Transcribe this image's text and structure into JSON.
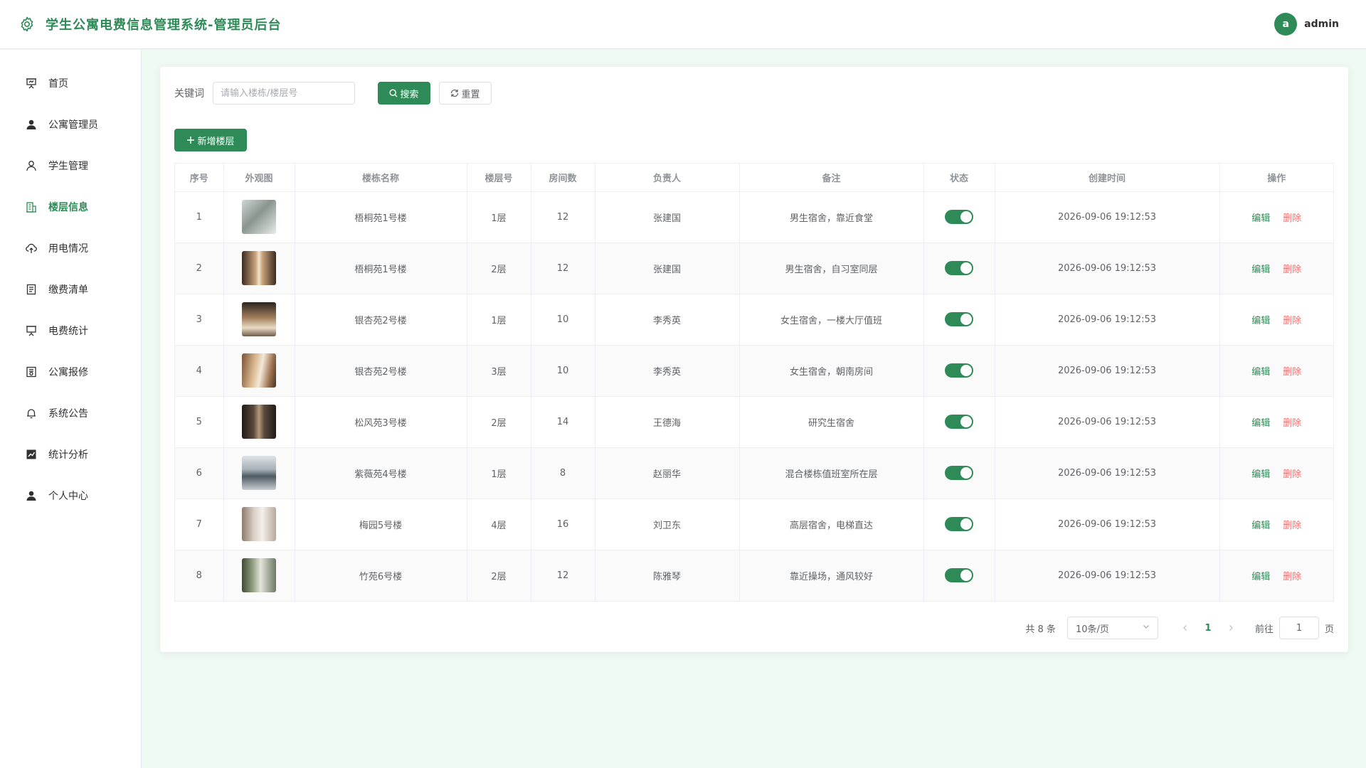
{
  "header": {
    "title": "学生公寓电费信息管理系统-管理员后台",
    "avatar_letter": "a",
    "username": "admin"
  },
  "colors": {
    "primary": "#2e8b57",
    "danger": "#f56c6c"
  },
  "sidebar": {
    "items": [
      {
        "label": "首页",
        "icon": "presentation-board-icon"
      },
      {
        "label": "公寓管理员",
        "icon": "user-filled-icon"
      },
      {
        "label": "学生管理",
        "icon": "user-outline-icon"
      },
      {
        "label": "楼层信息",
        "icon": "office-building-icon",
        "active": true
      },
      {
        "label": "用电情况",
        "icon": "upload-cloud-icon"
      },
      {
        "label": "缴费清单",
        "icon": "document-icon"
      },
      {
        "label": "电费统计",
        "icon": "monitor-board-icon"
      },
      {
        "label": "公寓报修",
        "icon": "memo-icon"
      },
      {
        "label": "系统公告",
        "icon": "bell-icon"
      },
      {
        "label": "统计分析",
        "icon": "data-line-icon"
      },
      {
        "label": "个人中心",
        "icon": "user-filled-icon"
      }
    ]
  },
  "search": {
    "label": "关键词",
    "placeholder": "请输入楼栋/楼层号",
    "search_button": "搜索",
    "reset_button": "重置"
  },
  "toolbar": {
    "add_button": "新增楼层"
  },
  "table": {
    "columns": [
      "序号",
      "外观图",
      "楼栋名称",
      "楼层号",
      "房间数",
      "负责人",
      "备注",
      "状态",
      "创建时间",
      "操作"
    ],
    "edit_label": "编辑",
    "delete_label": "删除",
    "rows": [
      {
        "index": "1",
        "building": "梧桐苑1号楼",
        "floor": "1层",
        "rooms": "12",
        "manager": "张建国",
        "remark": "男生宿舍，靠近食堂",
        "status": true,
        "created": "2026-09-06 19:12:53"
      },
      {
        "index": "2",
        "building": "梧桐苑1号楼",
        "floor": "2层",
        "rooms": "12",
        "manager": "张建国",
        "remark": "男生宿舍，自习室同层",
        "status": true,
        "created": "2026-09-06 19:12:53"
      },
      {
        "index": "3",
        "building": "银杏苑2号楼",
        "floor": "1层",
        "rooms": "10",
        "manager": "李秀英",
        "remark": "女生宿舍，一楼大厅值班",
        "status": true,
        "created": "2026-09-06 19:12:53"
      },
      {
        "index": "4",
        "building": "银杏苑2号楼",
        "floor": "3层",
        "rooms": "10",
        "manager": "李秀英",
        "remark": "女生宿舍，朝南房间",
        "status": true,
        "created": "2026-09-06 19:12:53"
      },
      {
        "index": "5",
        "building": "松风苑3号楼",
        "floor": "2层",
        "rooms": "14",
        "manager": "王德海",
        "remark": "研究生宿舍",
        "status": true,
        "created": "2026-09-06 19:12:53"
      },
      {
        "index": "6",
        "building": "紫薇苑4号楼",
        "floor": "1层",
        "rooms": "8",
        "manager": "赵丽华",
        "remark": "混合楼栋值班室所在层",
        "status": true,
        "created": "2026-09-06 19:12:53"
      },
      {
        "index": "7",
        "building": "梅园5号楼",
        "floor": "4层",
        "rooms": "16",
        "manager": "刘卫东",
        "remark": "高层宿舍，电梯直达",
        "status": true,
        "created": "2026-09-06 19:12:53"
      },
      {
        "index": "8",
        "building": "竹苑6号楼",
        "floor": "2层",
        "rooms": "12",
        "manager": "陈雅琴",
        "remark": "靠近操场，通风较好",
        "status": true,
        "created": "2026-09-06 19:12:53"
      }
    ]
  },
  "pagination": {
    "total_text": "共 8 条",
    "page_size": "10条/页",
    "current_page": "1",
    "goto_label": "前往",
    "goto_value": "1",
    "page_suffix": "页"
  }
}
